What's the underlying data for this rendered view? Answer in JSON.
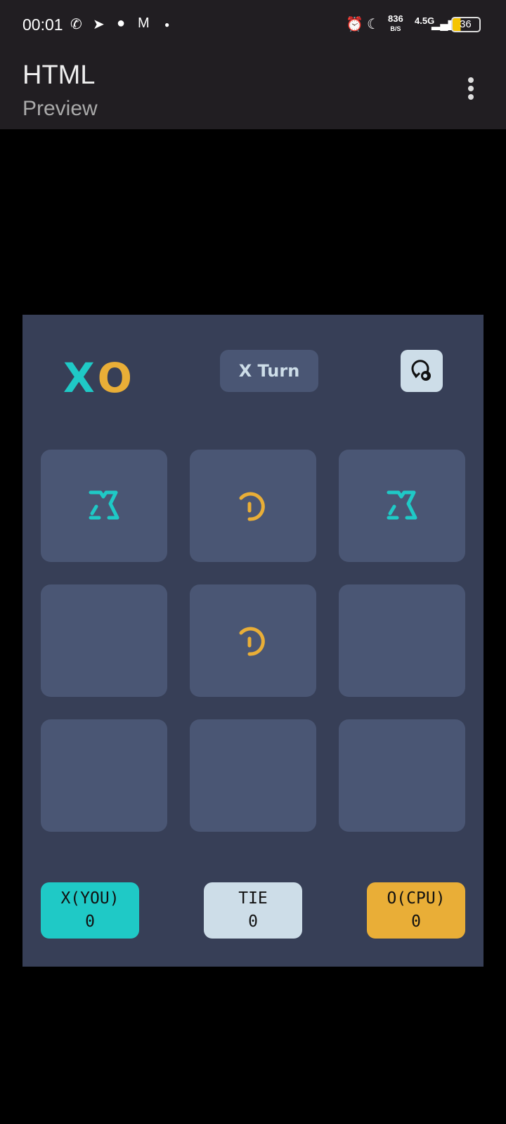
{
  "status_bar": {
    "time": "00:01",
    "net_speed": "836",
    "net_unit": "B/S",
    "network": "4.5G",
    "battery": "36"
  },
  "app_bar": {
    "title": "HTML",
    "subtitle": "Preview"
  },
  "game": {
    "logo_x": "X",
    "logo_o": "O",
    "turn_label": "X Turn",
    "board": [
      "X",
      "O",
      "X",
      "",
      "O",
      "",
      "",
      "",
      ""
    ],
    "scores": [
      {
        "label": "X(YOU)",
        "value": "0",
        "color": "#1fc9c6"
      },
      {
        "label": "TIE",
        "value": "0",
        "color": "#cddde8"
      },
      {
        "label": "O(CPU)",
        "value": "0",
        "color": "#e9ae37"
      }
    ]
  },
  "colors": {
    "x": "#1fc9c6",
    "o": "#e9ae37",
    "panel": "#373f57",
    "cell": "#4a5674"
  }
}
